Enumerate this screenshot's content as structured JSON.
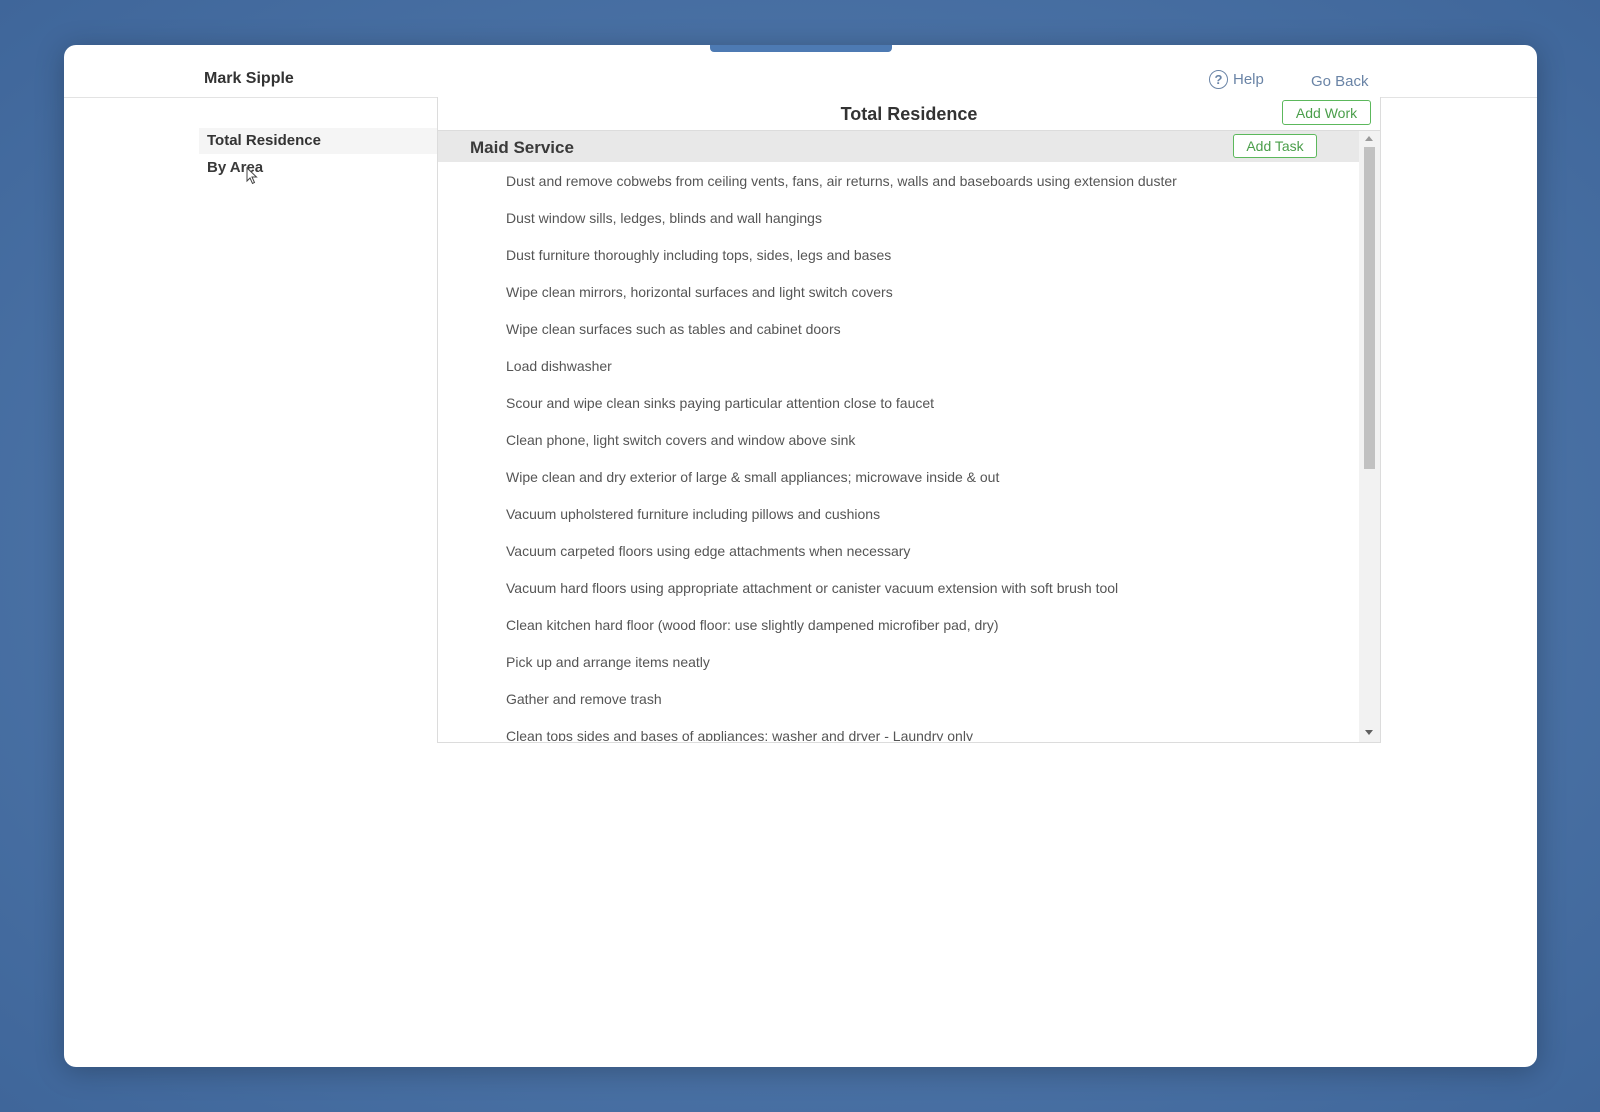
{
  "header": {
    "user_name": "Mark Sipple",
    "help_label": "Help",
    "help_icon_glyph": "?",
    "go_back_label": "Go Back"
  },
  "sidebar": {
    "items": [
      {
        "label": "Total Residence",
        "active": true
      },
      {
        "label": "By Area",
        "active": false
      }
    ]
  },
  "panel": {
    "title": "Total Residence",
    "add_work_label": "Add Work",
    "section": {
      "title": "Maid Service",
      "add_task_label": "Add Task",
      "tasks": [
        "Dust and remove cobwebs from ceiling vents, fans, air returns, walls and baseboards using extension duster",
        "Dust window sills, ledges, blinds and wall hangings",
        "Dust furniture thoroughly including tops, sides, legs and bases",
        "Wipe clean mirrors, horizontal surfaces and light switch covers",
        "Wipe clean surfaces such as tables and cabinet doors",
        "Load dishwasher",
        "Scour and wipe clean sinks paying particular attention close to faucet",
        "Clean phone, light switch covers and window above sink",
        "Wipe clean and dry exterior of large & small appliances; microwave inside & out",
        "Vacuum upholstered furniture including pillows and cushions",
        "Vacuum carpeted floors using edge attachments when necessary",
        "Vacuum hard floors using appropriate attachment or canister vacuum extension with soft brush tool",
        "Clean kitchen hard floor (wood floor: use slightly dampened microfiber pad, dry)",
        "Pick up and arrange items neatly",
        "Gather and remove trash",
        "Clean tops sides and bases of appliances: washer and dryer - Laundry only"
      ]
    }
  },
  "colors": {
    "accent_green": "#5cb85c",
    "link_blue": "#6a84a6",
    "background_blue": "#4e76a9"
  }
}
